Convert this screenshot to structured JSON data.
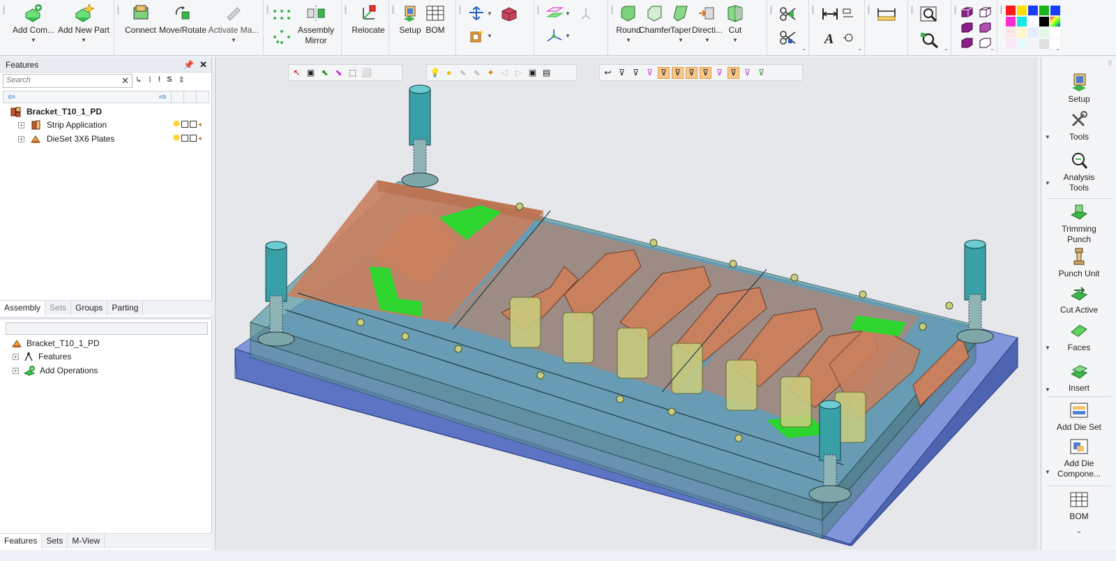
{
  "ribbon": {
    "groups": [
      {
        "buttons": [
          {
            "label": "Add Com...",
            "icon": "add-component-icon",
            "dropdown": true
          },
          {
            "label": "Add New Part",
            "icon": "add-new-part-icon",
            "dropdown": true
          }
        ]
      },
      {
        "buttons": [
          {
            "label": "Connect",
            "icon": "connect-icon"
          },
          {
            "label": "Move/Rotate",
            "icon": "move-rotate-icon"
          },
          {
            "label": "Activate Ma...",
            "icon": "activate-icon",
            "dropdown": true
          }
        ]
      },
      {
        "buttons": [
          {
            "label": "Assembly\nMirror",
            "icon": "assembly-mirror-icon"
          }
        ]
      },
      {
        "buttons": [
          {
            "label": "Relocate",
            "icon": "relocate-icon"
          }
        ]
      },
      {
        "buttons": [
          {
            "label": "Setup",
            "icon": "setup-icon"
          },
          {
            "label": "BOM",
            "icon": "bom-icon"
          }
        ]
      },
      {
        "buttons": [
          {
            "label": "Round",
            "icon": "round-icon",
            "dropdown": true
          },
          {
            "label": "Chamfer",
            "icon": "chamfer-icon"
          },
          {
            "label": "Taper",
            "icon": "taper-icon",
            "dropdown": true
          },
          {
            "label": "Directi...",
            "icon": "direct-icon",
            "dropdown": true
          },
          {
            "label": "Cut",
            "icon": "cut-icon",
            "dropdown": true
          }
        ]
      }
    ]
  },
  "features_panel": {
    "title": "Features",
    "search_placeholder": "Search",
    "root": "Bracket_T10_1_PD",
    "children": [
      "Strip Application",
      "DieSet 3X6 Plates"
    ],
    "tabs": [
      "Assembly",
      "Sets",
      "Groups",
      "Parting"
    ]
  },
  "process_panel": {
    "root": "Bracket_T10_1_PD",
    "children": [
      "Features",
      "Add Operations"
    ],
    "tabs": [
      "Features",
      "Sets",
      "M-View"
    ]
  },
  "right_toolbar": {
    "items": [
      "Setup",
      "Tools",
      "Analysis\nTools",
      "Trimming\nPunch",
      "Punch Unit",
      "Cut Active",
      "Faces",
      "Insert",
      "Add Die Set",
      "Add Die\nCompone...",
      "BOM"
    ]
  },
  "colors": {
    "plate_teal": "#5f9fa8",
    "base_blue": "#6f87d8",
    "strip_orange": "#c9805e",
    "highlight_green": "#2fd52f",
    "punch_yellow": "#c9cf7f",
    "accent_orange": "#f7c68b"
  }
}
